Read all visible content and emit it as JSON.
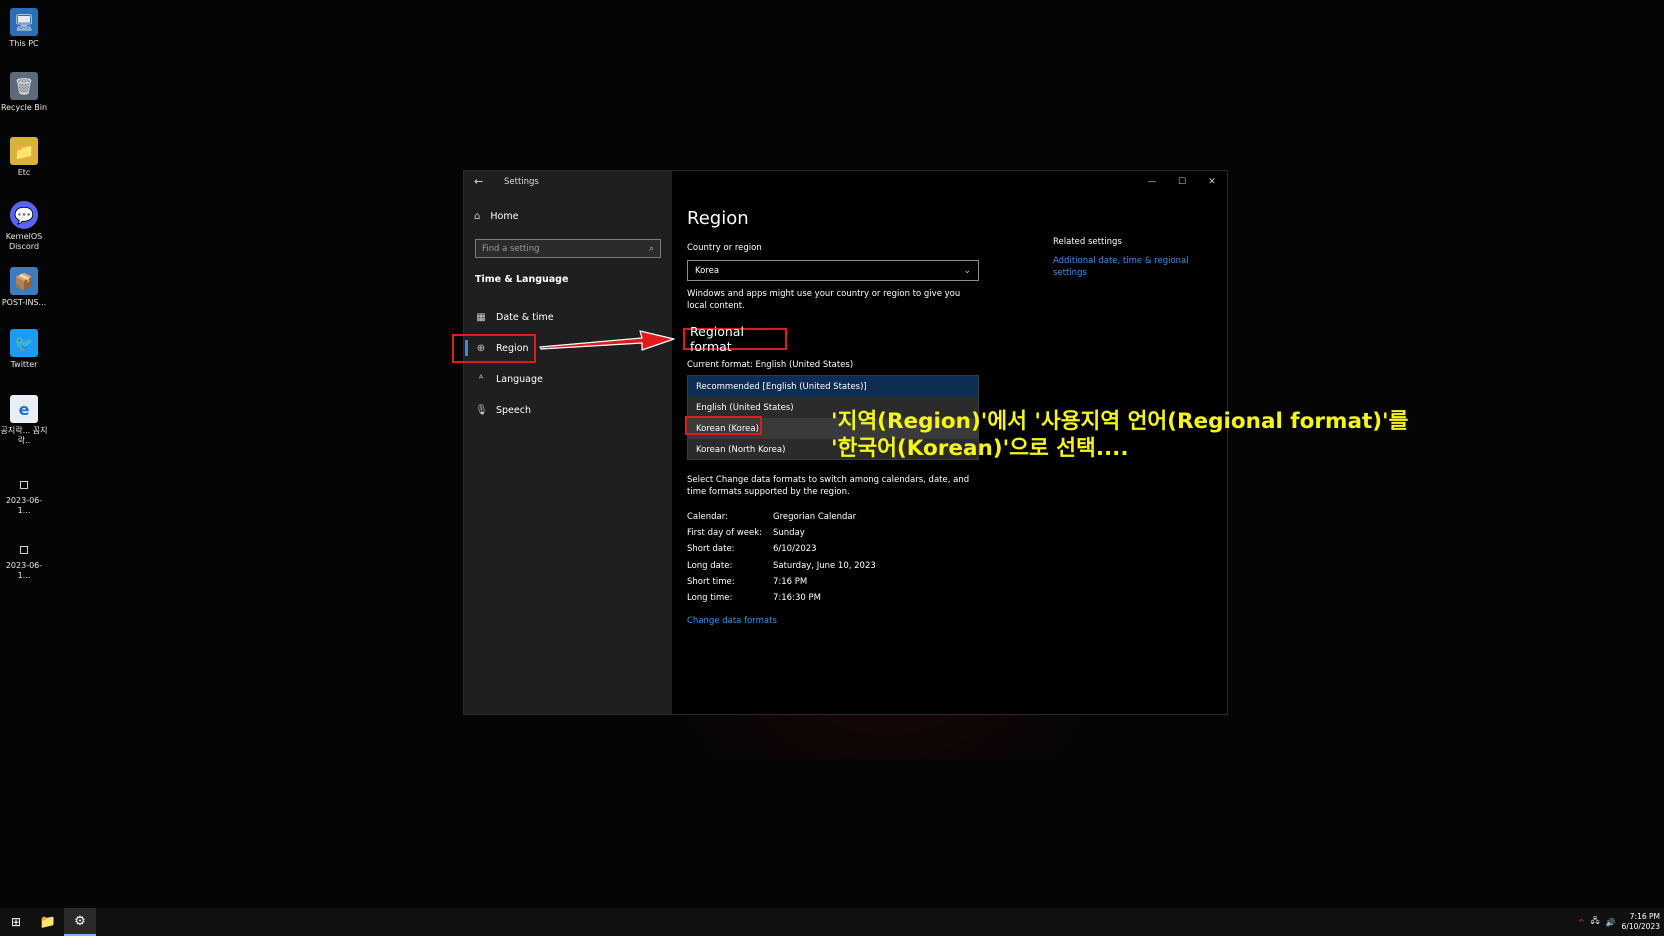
{
  "desktop": {
    "icons": [
      {
        "label": "This PC",
        "icon": "this-pc-icon",
        "glyph": "🖥"
      },
      {
        "label": "Recycle Bin",
        "icon": "recycle-bin-icon",
        "glyph": "🗑"
      },
      {
        "label": "Etc",
        "icon": "folder-icon",
        "glyph": "📁"
      },
      {
        "label": "KernelOS Discord",
        "icon": "discord-icon",
        "glyph": "💬"
      },
      {
        "label": "POST-INS...",
        "icon": "script-icon",
        "glyph": "📦"
      },
      {
        "label": "Twitter",
        "icon": "twitter-icon",
        "glyph": "🐦"
      },
      {
        "label": "공지락... 꼼지락..",
        "icon": "internet-explorer-icon",
        "glyph": "e"
      },
      {
        "label": "2023-06-1...",
        "icon": "file-icon",
        "glyph": "▫"
      },
      {
        "label": "2023-06-1...",
        "icon": "file-icon",
        "glyph": "▫"
      }
    ]
  },
  "window": {
    "title": "Settings",
    "home_label": "Home",
    "search_placeholder": "Find a setting",
    "section_title": "Time & Language",
    "nav": [
      {
        "label": "Date & time",
        "icon": "calendar-clock-icon"
      },
      {
        "label": "Region",
        "icon": "globe-icon"
      },
      {
        "label": "Language",
        "icon": "language-icon"
      },
      {
        "label": "Speech",
        "icon": "microphone-icon"
      }
    ]
  },
  "region": {
    "page_title": "Region",
    "country_label": "Country or region",
    "country_value": "Korea",
    "country_desc": "Windows and apps might use your country or region to give you local content.",
    "regional_format_heading": "Regional format",
    "current_format": "Current format: English (United States)",
    "format_options": [
      "Recommended [English (United States)]",
      "English (United States)",
      "Korean (Korea)",
      "Korean (North Korea)"
    ],
    "change_desc": "Select Change data formats to switch among calendars, date, and time formats supported by the region.",
    "formats": [
      {
        "k": "Calendar:",
        "v": "Gregorian Calendar"
      },
      {
        "k": "First day of week:",
        "v": "Sunday"
      },
      {
        "k": "Short date:",
        "v": "6/10/2023"
      },
      {
        "k": "Long date:",
        "v": "Saturday, June 10, 2023"
      },
      {
        "k": "Short time:",
        "v": "7:16 PM"
      },
      {
        "k": "Long time:",
        "v": "7:16:30 PM"
      }
    ],
    "change_link": "Change data formats",
    "related_heading": "Related settings",
    "related_link": "Additional date, time & regional settings"
  },
  "annotation": {
    "line1": "'지역(Region)'에서 '사용지역 언어(Regional format)'를",
    "line2": "'한국어(Korean)'으로 선택...."
  },
  "taskbar": {
    "time": "7:16 PM",
    "date": "6/10/2023"
  },
  "colors": {
    "accent": "#2f8ee0",
    "highlight_box": "#e01b1b",
    "annotation": "#f5f51a",
    "link": "#3d8fe0"
  }
}
